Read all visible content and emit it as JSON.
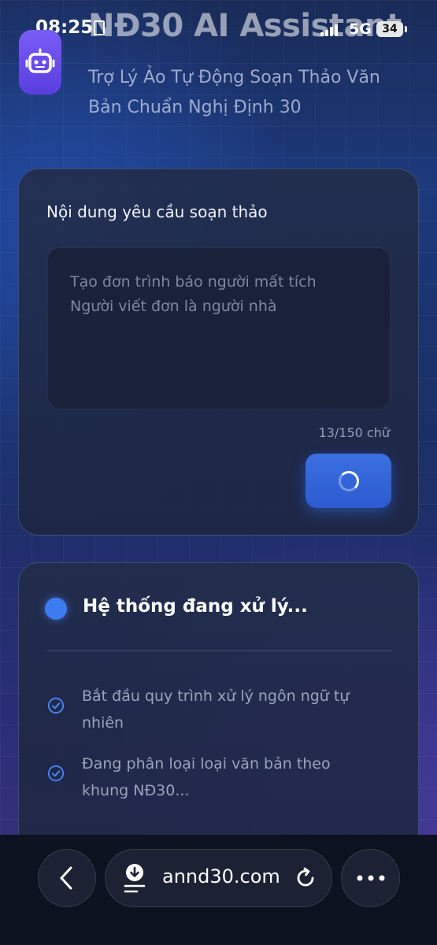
{
  "status_bar": {
    "time": "08:25",
    "network": "5G",
    "battery": "34"
  },
  "header": {
    "title": "NĐ30 AI Assistant",
    "subtitle": "Trợ Lý Ảo Tự Động Soạn Thảo Văn Bản Chuẩn Nghị Định 30",
    "logo_icon": "robot-icon"
  },
  "request_card": {
    "label": "Nội dung yêu cầu soạn thảo",
    "input_value": "Tạo đơn trình báo người mất tích\nNgười viết đơn là người nhà",
    "char_count": "13/150 chữ",
    "submit_state_icon": "loading-spinner-icon"
  },
  "processing_card": {
    "status_title": "Hệ thống đang xử lý...",
    "steps": [
      {
        "icon": "check-circle-icon",
        "text": "Bắt đầu quy trình xử lý ngôn ngữ tự nhiên"
      },
      {
        "icon": "check-circle-icon",
        "text": "Đang phân loại loại văn bản theo khung NĐ30..."
      }
    ]
  },
  "browser_bar": {
    "url": "annd30.com",
    "back_icon": "chevron-left-icon",
    "download_icon": "download-icon",
    "reload_icon": "reload-icon",
    "more_icon": "more-icon"
  },
  "colors": {
    "accent": "#3d7bf0",
    "logo": "#6a4ef0"
  }
}
